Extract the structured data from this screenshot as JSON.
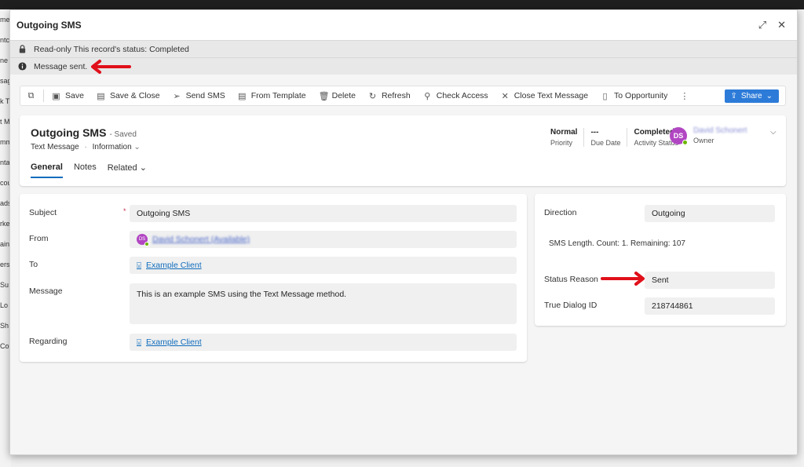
{
  "background": {
    "left_fragments": [
      "me",
      "ntc",
      "ne",
      "sag",
      "k T",
      "t M",
      "mm",
      "nta",
      "cou",
      "ads",
      "rke",
      "ain",
      "ers",
      "Su",
      "Lo",
      "Sh",
      "Co"
    ]
  },
  "dialog": {
    "title": "Outgoing SMS",
    "notices": [
      {
        "icon": "lock-icon",
        "text": "Read-only This record's status: Completed"
      },
      {
        "icon": "info-icon",
        "text": "Message sent."
      }
    ]
  },
  "commands": [
    {
      "icon": "new-window-icon",
      "label": ""
    },
    {
      "icon": "save-icon",
      "label": "Save"
    },
    {
      "icon": "save-close-icon",
      "label": "Save & Close"
    },
    {
      "icon": "send-icon",
      "label": "Send SMS"
    },
    {
      "icon": "template-icon",
      "label": "From Template"
    },
    {
      "icon": "delete-icon",
      "label": "Delete"
    },
    {
      "icon": "refresh-icon",
      "label": "Refresh"
    },
    {
      "icon": "check-access-icon",
      "label": "Check Access"
    },
    {
      "icon": "close-icon",
      "label": "Close Text Message"
    },
    {
      "icon": "document-icon",
      "label": "To Opportunity"
    },
    {
      "icon": "more-icon",
      "label": ""
    }
  ],
  "share_label": "Share",
  "record": {
    "title": "Outgoing SMS",
    "saved": "- Saved",
    "entity": "Text Message",
    "form": "Information",
    "tabs": [
      "General",
      "Notes",
      "Related"
    ],
    "header_fields": [
      {
        "value": "Normal",
        "label": "Priority"
      },
      {
        "value": "---",
        "label": "Due Date"
      },
      {
        "value": "Completed",
        "label": "Activity Status"
      }
    ],
    "owner": {
      "initials": "DS",
      "name": "David Schonert",
      "label": "Owner"
    }
  },
  "general": {
    "subject_label": "Subject",
    "subject_value": "Outgoing SMS",
    "from_label": "From",
    "from_initials": "DS",
    "from_value": "David Schonert (Available)",
    "to_label": "To",
    "to_value": "Example Client",
    "message_label": "Message",
    "message_value": "This is an example SMS using the Text Message method.",
    "regarding_label": "Regarding",
    "regarding_value": "Example Client"
  },
  "side": {
    "direction_label": "Direction",
    "direction_value": "Outgoing",
    "sms_length": "SMS Length. Count: 1. Remaining: 107",
    "status_reason_label": "Status Reason",
    "status_reason_value": "Sent",
    "true_dialog_label": "True Dialog ID",
    "true_dialog_value": "218744861"
  },
  "colors": {
    "accent": "#0f6cbd",
    "annotation_arrow": "#e0101a",
    "avatar": "#b146c2",
    "presence": "#6bb700"
  }
}
